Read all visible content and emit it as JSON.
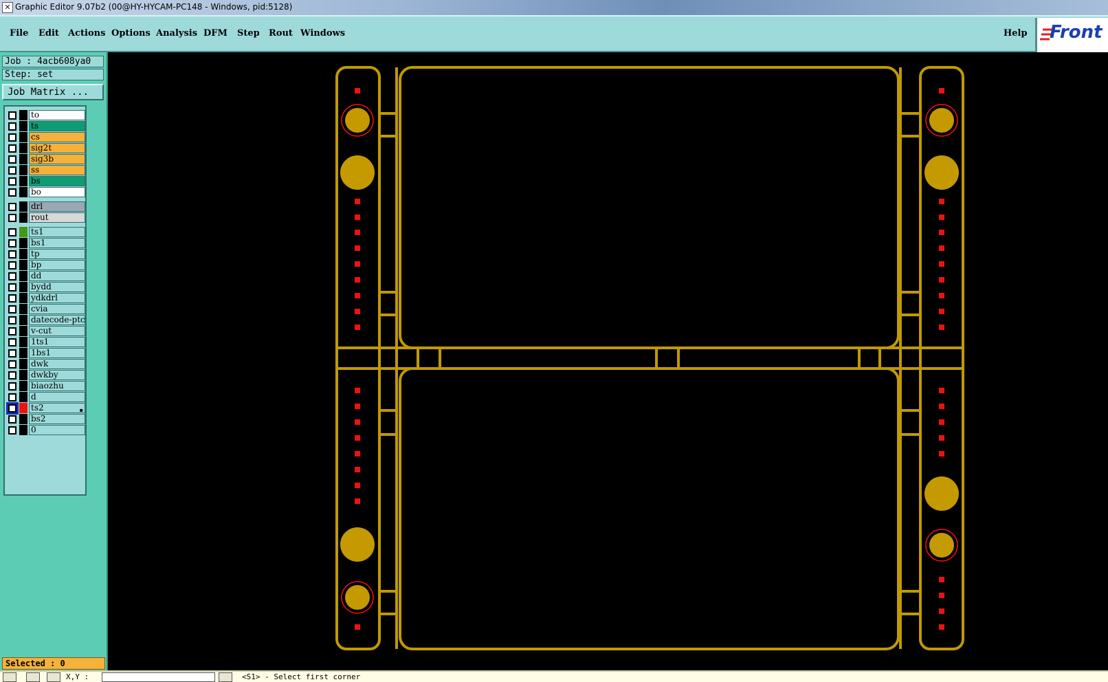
{
  "window": {
    "title": "Graphic Editor 9.07b2 (00@HY-HYCAM-PC148 - Windows, pid:5128)",
    "icon": "x-app-icon"
  },
  "menu": {
    "items": [
      {
        "label": "File",
        "id": "file"
      },
      {
        "label": "Edit",
        "id": "edit"
      },
      {
        "label": "Actions",
        "id": "actions"
      },
      {
        "label": "Options",
        "id": "options"
      },
      {
        "label": "Analysis",
        "id": "analysis"
      },
      {
        "label": "DFM",
        "id": "dfm"
      },
      {
        "label": "Step",
        "id": "step"
      },
      {
        "label": "Rout",
        "id": "rout"
      },
      {
        "label": "Windows",
        "id": "windows"
      }
    ],
    "help": "Help",
    "logo": "Front"
  },
  "panel": {
    "job": "Job : 4acb608ya0",
    "step": "Step: set",
    "job_matrix": "Job Matrix ...",
    "selected": "Selected : 0"
  },
  "layers": [
    {
      "name": "to",
      "color": "#ffffff",
      "swatch": "#000000"
    },
    {
      "name": "ts",
      "color": "#0f9c74",
      "swatch": "#000000"
    },
    {
      "name": "cs",
      "color": "#f5b13a",
      "swatch": "#000000"
    },
    {
      "name": "sig2t",
      "color": "#f5b13a",
      "swatch": "#000000"
    },
    {
      "name": "sig3b",
      "color": "#f5b13a",
      "swatch": "#000000"
    },
    {
      "name": "ss",
      "color": "#f5b13a",
      "swatch": "#000000"
    },
    {
      "name": "bs",
      "color": "#0f9c74",
      "swatch": "#000000"
    },
    {
      "name": "bo",
      "color": "#ffffff",
      "swatch": "#000000"
    },
    {
      "name": "drl",
      "color": "#9aa8b4",
      "swatch": "#000000"
    },
    {
      "name": "rout",
      "color": "#d8d8d8",
      "swatch": "#000000"
    },
    {
      "name": "ts1",
      "color": "#9edada",
      "swatch": "#3f9a1c"
    },
    {
      "name": "bs1",
      "color": "#9edada",
      "swatch": "#000000"
    },
    {
      "name": "tp",
      "color": "#9edada",
      "swatch": "#000000"
    },
    {
      "name": "bp",
      "color": "#9edada",
      "swatch": "#000000"
    },
    {
      "name": "dd",
      "color": "#9edada",
      "swatch": "#000000"
    },
    {
      "name": "bydd",
      "color": "#9edada",
      "swatch": "#000000"
    },
    {
      "name": "ydkdrl",
      "color": "#9edada",
      "swatch": "#000000"
    },
    {
      "name": "cvia",
      "color": "#9edada",
      "swatch": "#000000"
    },
    {
      "name": "datecode-ptc",
      "color": "#9edada",
      "swatch": "#000000"
    },
    {
      "name": "v-cut",
      "color": "#9edada",
      "swatch": "#000000"
    },
    {
      "name": "1ts1",
      "color": "#9edada",
      "swatch": "#000000"
    },
    {
      "name": "1bs1",
      "color": "#9edada",
      "swatch": "#000000"
    },
    {
      "name": "dwk",
      "color": "#9edada",
      "swatch": "#000000"
    },
    {
      "name": "dwkby",
      "color": "#9edada",
      "swatch": "#000000"
    },
    {
      "name": "biaozhu",
      "color": "#9edada",
      "swatch": "#000000"
    },
    {
      "name": "d",
      "color": "#9edada",
      "swatch": "#000000"
    },
    {
      "name": "ts2",
      "color": "#9edada",
      "swatch": "#ee1111",
      "active": true
    },
    {
      "name": "bs2",
      "color": "#9edada",
      "swatch": "#000000"
    },
    {
      "name": "0",
      "color": "#9edada",
      "swatch": "#000000"
    }
  ],
  "bottom": {
    "xy_label": "X,Y :",
    "prompt": "<S1> - Select first corner"
  },
  "colors": {
    "trace": "#c09a00",
    "pad": "#c49a00",
    "red_marker": "#ee1111",
    "canvas_bg": "#000000"
  }
}
